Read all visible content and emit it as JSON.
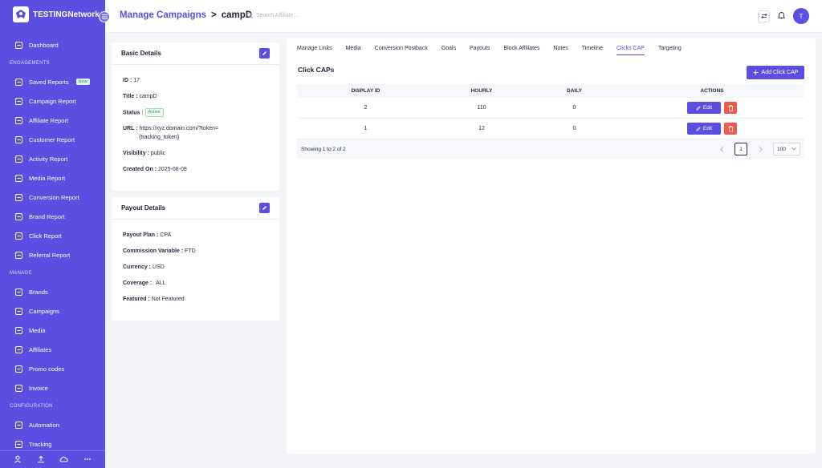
{
  "app": {
    "name": "TESTINGNetwork"
  },
  "sidebar": {
    "items": [
      {
        "type": "item",
        "label": "Dashboard",
        "icon": "dashboard-icon"
      },
      {
        "type": "section",
        "label": "ENGAGEMENTS"
      },
      {
        "type": "item",
        "label": "Saved Reports",
        "icon": "saved-reports-icon",
        "badge": "New"
      },
      {
        "type": "item",
        "label": "Campaign Report",
        "icon": "campaign-report-icon"
      },
      {
        "type": "item",
        "label": "Affiliate Report",
        "icon": "affiliate-report-icon"
      },
      {
        "type": "item",
        "label": "Customer Report",
        "icon": "customer-report-icon"
      },
      {
        "type": "item",
        "label": "Activity Report",
        "icon": "activity-report-icon"
      },
      {
        "type": "item",
        "label": "Media Report",
        "icon": "media-report-icon"
      },
      {
        "type": "item",
        "label": "Conversion Report",
        "icon": "conversion-report-icon"
      },
      {
        "type": "item",
        "label": "Brand Report",
        "icon": "brand-report-icon"
      },
      {
        "type": "item",
        "label": "Click Report",
        "icon": "click-report-icon"
      },
      {
        "type": "item",
        "label": "Referral Report",
        "icon": "referral-report-icon"
      },
      {
        "type": "section",
        "label": "MANAGE"
      },
      {
        "type": "item",
        "label": "Brands",
        "icon": "brands-icon"
      },
      {
        "type": "item",
        "label": "Campaigns",
        "icon": "campaigns-icon"
      },
      {
        "type": "item",
        "label": "Media",
        "icon": "media-icon"
      },
      {
        "type": "item",
        "label": "Affiliates",
        "icon": "affiliates-icon"
      },
      {
        "type": "item",
        "label": "Promo codes",
        "icon": "promo-codes-icon"
      },
      {
        "type": "item",
        "label": "Invoice",
        "icon": "invoice-icon"
      },
      {
        "type": "section",
        "label": "CONFIGURATION"
      },
      {
        "type": "item",
        "label": "Automation",
        "icon": "automation-icon"
      },
      {
        "type": "item",
        "label": "Tracking",
        "icon": "tracking-icon"
      }
    ],
    "footer_icons": [
      "user-icon",
      "upload-icon",
      "cloud-icon",
      "more-icon"
    ]
  },
  "header": {
    "title": "Manage Campaigns",
    "separator": ">",
    "campaign": "campD",
    "search_placeholder": "Search Affiliate...",
    "avatar_initial": "T"
  },
  "basic_details": {
    "title": "Basic Details",
    "id_label": "ID :",
    "id": "17",
    "title_label": "Title :",
    "title_value": "campD",
    "status_label": "Status :",
    "status": "Active",
    "url_label": "URL :",
    "url_line1": "https://xyz.domain.com/?token=",
    "url_line2": "{tracking_token}",
    "visibility_label": "Visibility :",
    "visibility": "public",
    "created_label": "Created On :",
    "created": "2025-08-08"
  },
  "payout_details": {
    "title": "Payout Details",
    "plan_label": "Payout Plan :",
    "plan": "CPA",
    "commission_label": "Commission Variable :",
    "commission": "FTD",
    "currency_label": "Currency :",
    "currency": "USD",
    "coverage_label": "Coverage :",
    "coverage": "ALL",
    "featured_label": "Featured :",
    "featured": "Not Featured"
  },
  "tabs": [
    "Manage Links",
    "Media",
    "Conversion Postback",
    "Goals",
    "Payouts",
    "Block Affiliates",
    "Notes",
    "Timeline",
    "Clicks CAP",
    "Targeting"
  ],
  "active_tab": "Clicks CAP",
  "clicks_cap": {
    "title": "Click CAPs",
    "add_label": "Add Click CAP",
    "columns": [
      "DISPLAY ID",
      "HOURLY",
      "DAILY",
      "ACTIONS"
    ],
    "rows": [
      {
        "display_id": "2",
        "hourly": "110",
        "daily": "0"
      },
      {
        "display_id": "1",
        "hourly": "12",
        "daily": "0"
      }
    ],
    "edit_label": "Edit",
    "showing": "Showing 1 to 2 of 2",
    "current_page": "1",
    "page_size": "100"
  },
  "colors": {
    "accent": "#5a4fe0",
    "danger": "#ef5a4d",
    "success": "#2f9e55"
  }
}
